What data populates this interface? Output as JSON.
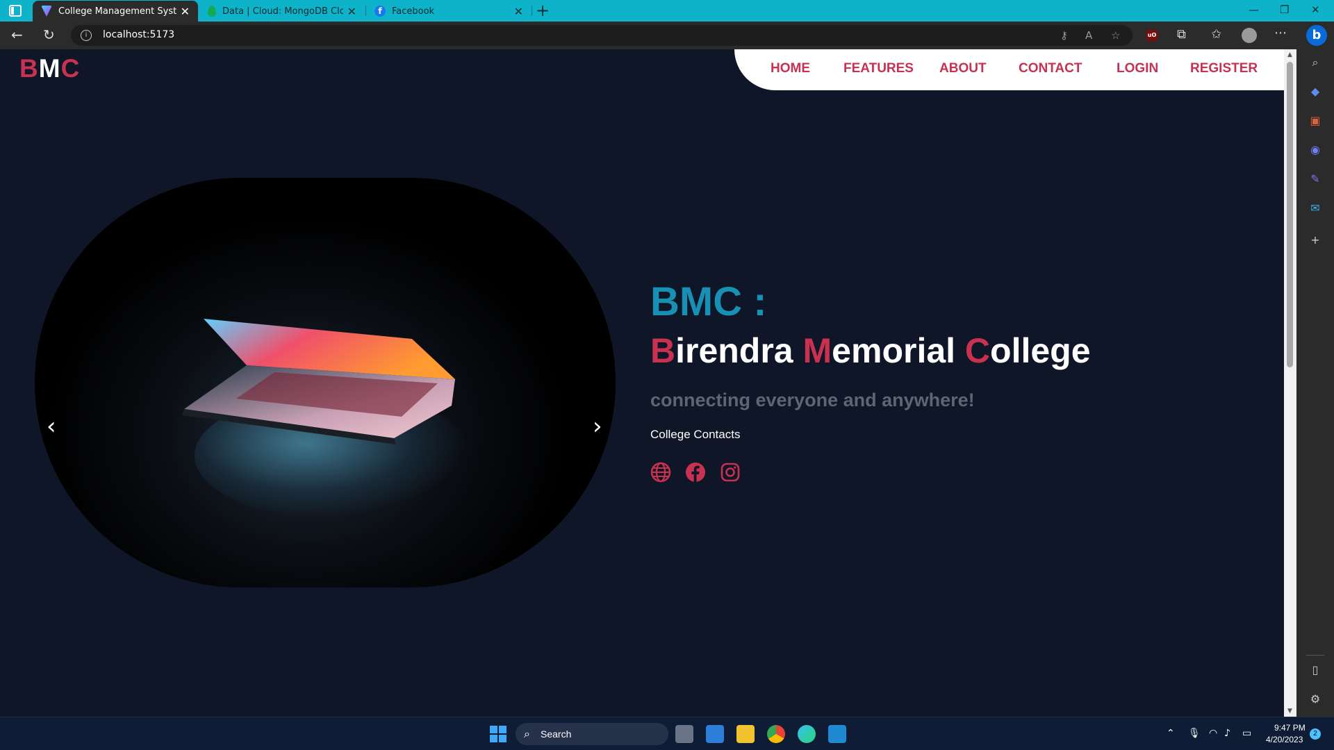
{
  "browser": {
    "tabs": [
      {
        "title": "College Management System",
        "active": true
      },
      {
        "title": "Data | Cloud: MongoDB Cloud",
        "active": false
      },
      {
        "title": "Facebook",
        "active": false
      }
    ],
    "url": "localhost:5173"
  },
  "site": {
    "logo": {
      "b": "B",
      "m": "M",
      "c": "C"
    },
    "nav": [
      "HOME",
      "FEATURES",
      "ABOUT",
      "CONTACT",
      "LOGIN",
      "REGISTER"
    ],
    "hero": {
      "heading": "BMC :",
      "name_parts": {
        "b_initial": "B",
        "b_rest": "irendra ",
        "m_initial": "M",
        "m_rest": "emorial ",
        "c_initial": "C",
        "c_rest": "ollege"
      },
      "tagline": "connecting everyone and anywhere!",
      "contacts_label": "College Contacts",
      "carousel_prev": "‹",
      "carousel_next": "›"
    },
    "social_icons": [
      "globe-icon",
      "facebook-icon",
      "instagram-icon"
    ]
  },
  "taskbar": {
    "search_label": "Search",
    "time": "9:47 PM",
    "date": "4/20/2023",
    "notification_count": "2"
  },
  "colors": {
    "accent": "#c8314f",
    "heading_blue": "#1890b4",
    "page_bg": "#0f1628",
    "tab_bar": "#0fb3c9"
  }
}
